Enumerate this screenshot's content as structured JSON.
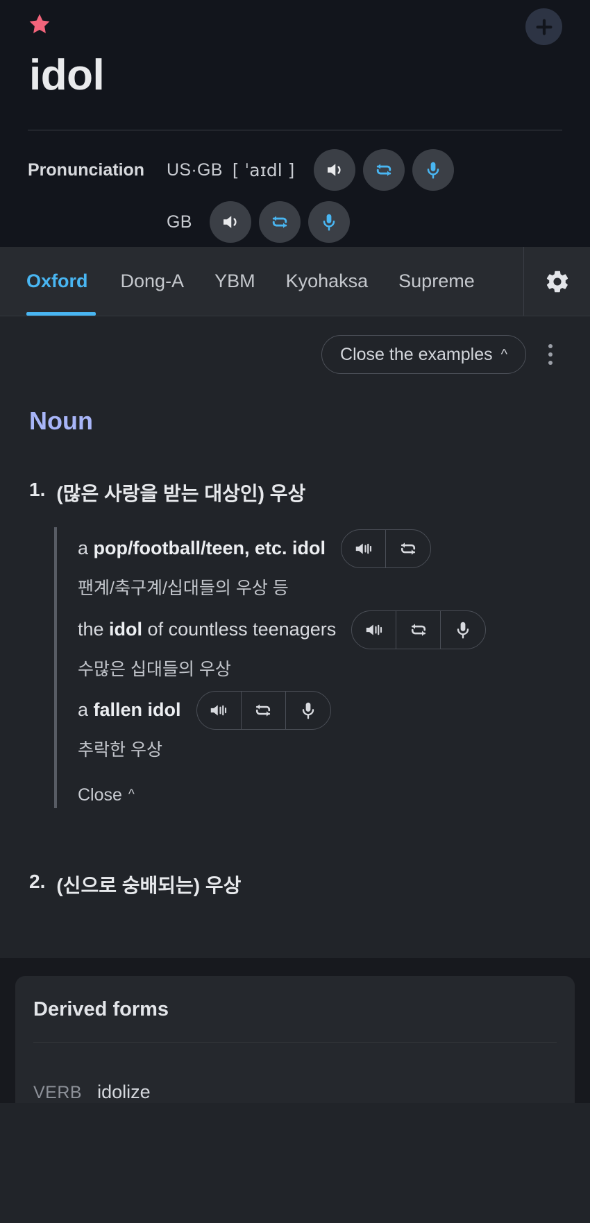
{
  "header": {
    "favorite_icon": "star-icon",
    "add_icon": "plus-icon",
    "headword": "idol",
    "pronunciation_label": "Pronunciation",
    "rows": [
      {
        "region": "US·GB",
        "ipa": "[ ˈaɪdl ]",
        "buttons": [
          "speaker-icon",
          "repeat-icon",
          "microphone-icon"
        ]
      },
      {
        "region": "GB",
        "ipa": "",
        "buttons": [
          "speaker-icon",
          "repeat-icon",
          "microphone-icon"
        ]
      }
    ]
  },
  "tabs": {
    "items": [
      {
        "label": "Oxford",
        "active": true
      },
      {
        "label": "Dong-A",
        "active": false
      },
      {
        "label": "YBM",
        "active": false
      },
      {
        "label": "Kyohaksa",
        "active": false
      },
      {
        "label": "Supreme",
        "active": false
      }
    ],
    "settings_icon": "gear-icon",
    "accent_color": "#49b6f2"
  },
  "toolbar": {
    "close_examples_label": "Close the examples",
    "chevron": "˄",
    "more_icon": "kebab-menu-icon"
  },
  "entry": {
    "part_of_speech": "Noun",
    "pos_color": "#a8b5f8",
    "senses": [
      {
        "number": "1.",
        "definition": "(많은 사랑을 받는 대상인) 우상",
        "examples": [
          {
            "prefix": "a ",
            "bold": "pop/football/teen, etc. idol",
            "suffix": "",
            "translation": "팬계/축구계/십대들의 우상 등",
            "buttons": [
              "speaker-icon",
              "repeat-icon"
            ]
          },
          {
            "prefix": "the ",
            "bold": "idol",
            "suffix": " of countless teenagers",
            "translation": "수많은 십대들의 우상",
            "buttons": [
              "speaker-icon",
              "repeat-icon",
              "microphone-icon"
            ]
          },
          {
            "prefix": "a ",
            "bold": "fallen idol",
            "suffix": "",
            "translation": "추락한 우상",
            "buttons": [
              "speaker-icon",
              "repeat-icon",
              "microphone-icon"
            ]
          }
        ],
        "close_label": "Close"
      },
      {
        "number": "2.",
        "definition": "(신으로 숭배되는) 우상",
        "examples": [],
        "close_label": ""
      }
    ]
  },
  "derived_forms": {
    "title": "Derived forms",
    "rows": [
      {
        "pos": "VERB",
        "word": "idolize"
      }
    ]
  }
}
